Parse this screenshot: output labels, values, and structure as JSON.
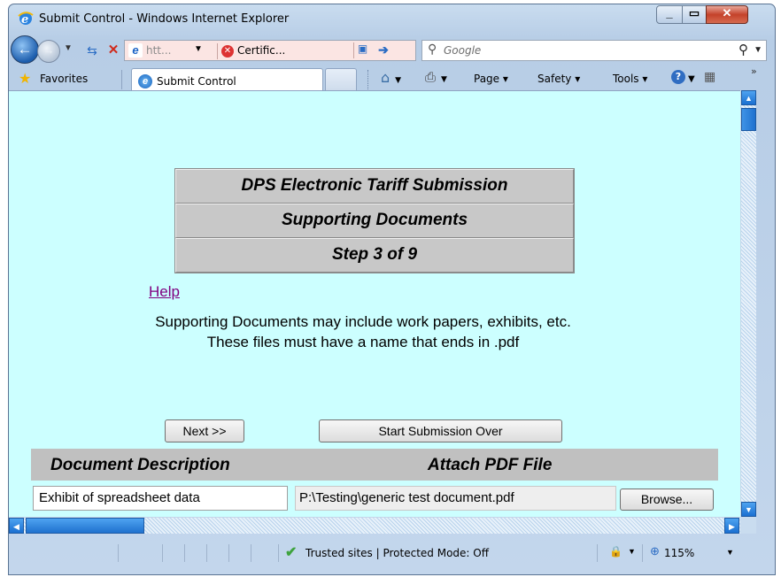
{
  "window": {
    "title": "Submit Control - Windows Internet Explorer"
  },
  "address_bar": {
    "url": "htt...",
    "certificate": "Certific...",
    "search_placeholder": "Google"
  },
  "favorites_bar": {
    "favorites_label": "Favorites",
    "tab_label": "Submit Control"
  },
  "command_bar": {
    "page_label": "Page",
    "safety_label": "Safety",
    "tools_label": "Tools"
  },
  "page": {
    "header_rows": [
      "DPS Electronic Tariff Submission",
      "Supporting Documents",
      "Step 3 of 9"
    ],
    "help_link": "Help",
    "info_text": "Supporting Documents may include work papers, exhibits, etc. These files must have a name that ends in .pdf",
    "next_button": "Next >>",
    "start_over_button": "Start Submission Over",
    "col_description": "Document Description",
    "col_attach": "Attach PDF File",
    "description_value": "Exhibit of spreadsheet data",
    "file_value": "P:\\Testing\\generic test document.pdf",
    "browse_button": "Browse..."
  },
  "status_bar": {
    "zone_text": "Trusted sites | Protected Mode: Off",
    "zoom": "115%"
  },
  "colors": {
    "page_background": "#ccffff",
    "header_gray": "#c8c8c8",
    "visited_link": "#800080"
  }
}
